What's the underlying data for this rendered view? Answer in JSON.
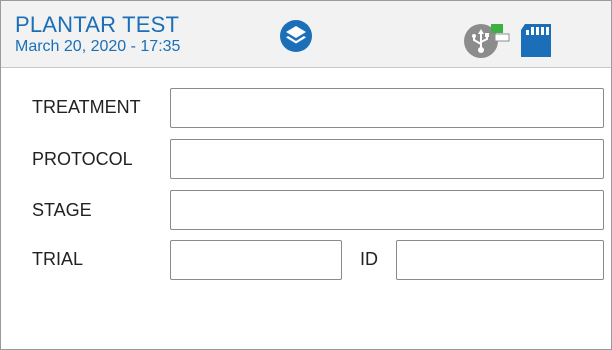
{
  "header": {
    "title": "PLANTAR TEST",
    "datetime": "March 20, 2020 - 17:35",
    "icons": {
      "layers": "layers-icon",
      "usb": "usb-icon",
      "sd": "sd-card-icon"
    },
    "accent_color": "#1a6fb8",
    "usb_badge_color": "#3cb043"
  },
  "form": {
    "treatment": {
      "label": "TREATMENT",
      "value": ""
    },
    "protocol": {
      "label": "PROTOCOL",
      "value": ""
    },
    "stage": {
      "label": "STAGE",
      "value": ""
    },
    "trial": {
      "label": "TRIAL",
      "value": ""
    },
    "id": {
      "label": "ID",
      "value": ""
    }
  }
}
